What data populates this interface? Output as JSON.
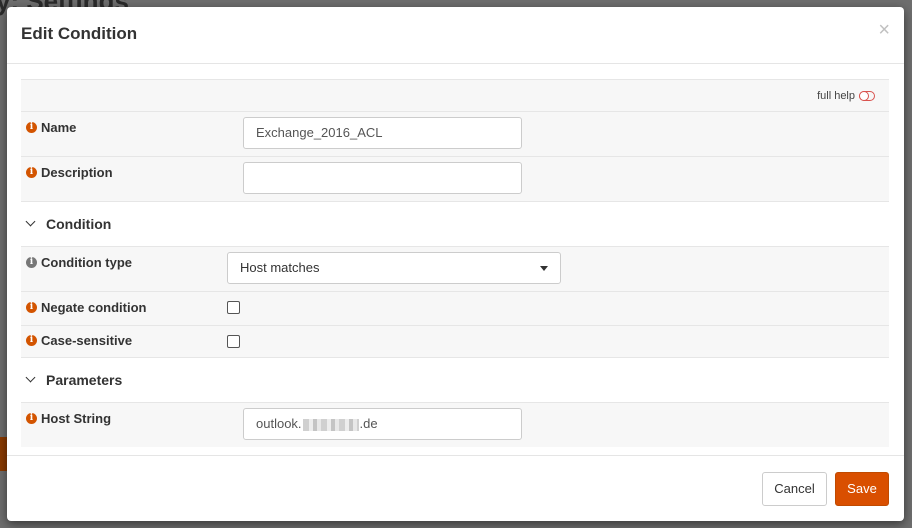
{
  "background": {
    "page_title": "y: Settings"
  },
  "modal": {
    "title": "Edit Condition",
    "close_label": "×",
    "full_help_label": "full help",
    "fields": {
      "name": {
        "label": "Name",
        "value": "Exchange_2016_ACL"
      },
      "description": {
        "label": "Description",
        "value": ""
      }
    },
    "sections": {
      "condition": {
        "title": "Condition",
        "condition_type": {
          "label": "Condition type",
          "selected": "Host matches"
        },
        "negate": {
          "label": "Negate condition",
          "checked": false
        },
        "case_sensitive": {
          "label": "Case-sensitive",
          "checked": false
        }
      },
      "parameters": {
        "title": "Parameters",
        "host_string": {
          "label": "Host String",
          "value_prefix": "outlook.",
          "value_suffix": ".de"
        }
      }
    },
    "buttons": {
      "cancel": "Cancel",
      "save": "Save"
    },
    "colors": {
      "accent": "#d94f00",
      "info_icon": "#d35400"
    }
  }
}
